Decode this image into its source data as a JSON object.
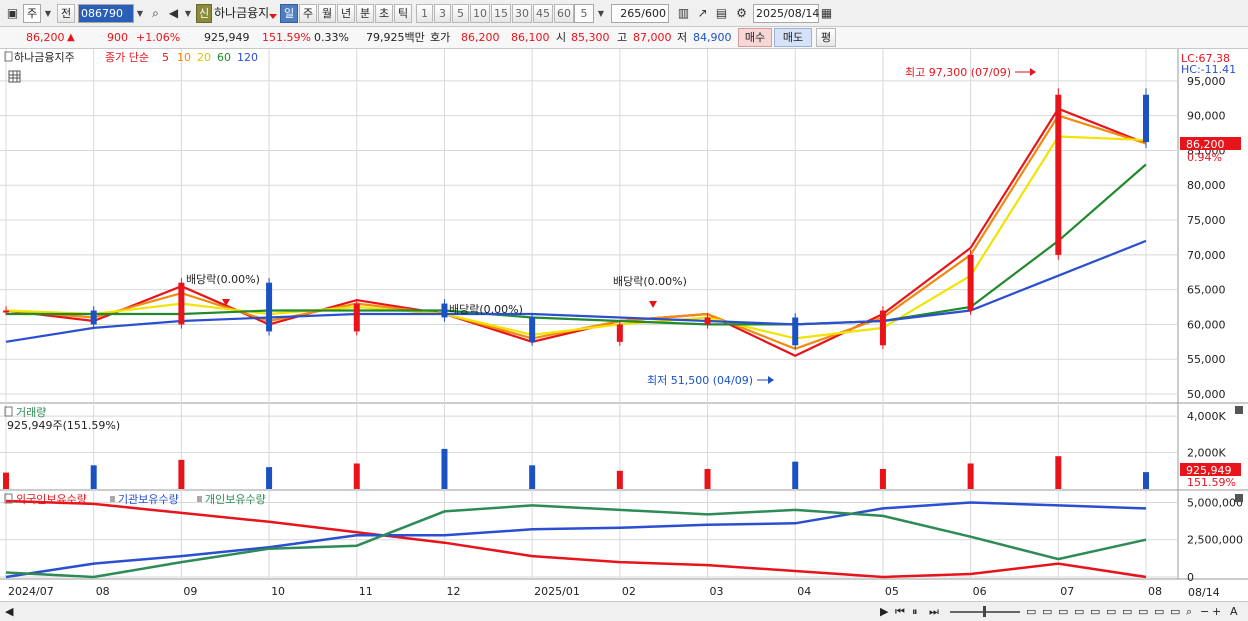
{
  "toolbar": {
    "market_type": "주",
    "prev_label": "전",
    "stock_code": "086790",
    "stock_name": "하나금융지",
    "new_badge": "신",
    "periods": [
      "일",
      "주",
      "월",
      "년",
      "분",
      "초",
      "틱"
    ],
    "selected_period": "일",
    "intervals": [
      "1",
      "3",
      "5",
      "10",
      "15",
      "30",
      "45",
      "60"
    ],
    "interval_value": "5",
    "count_current": "265",
    "count_total": "/600",
    "date": "2025/08/14"
  },
  "quote": {
    "price": "86,200",
    "change": "900",
    "change_pct": "+1.06%",
    "volume": "925,949",
    "volume_ratio": "151.59%",
    "turnover": "0.33%",
    "amount": "79,925백만",
    "bid_label": "호가",
    "ask_price": "86,200",
    "bid_price": "86,100",
    "open_label": "시",
    "open": "85,300",
    "high_label": "고",
    "high": "87,000",
    "low_label": "저",
    "low": "84,900",
    "buy_label": "매수",
    "sell_label": "매도",
    "eval_label": "평"
  },
  "price_panel": {
    "title": "하나금융지주",
    "ma_label": "종가 단순",
    "ma_periods": [
      "5",
      "10",
      "20",
      "60",
      "120"
    ],
    "ma_colors": [
      "#e8141b",
      "#f08a10",
      "#f2e300",
      "#1f8a2e",
      "#2a4fd0"
    ],
    "lc": "LC:67.38",
    "hc": "HC:-11.41",
    "current_price": "86,200",
    "current_pct": "0.94%",
    "y_ticks": [
      "95,000",
      "90,000",
      "85,000",
      "80,000",
      "75,000",
      "70,000",
      "65,000",
      "60,000",
      "55,000",
      "50,000"
    ],
    "high_note": "최고 97,300 (07/09)",
    "low_note": "최저 51,500 (04/09)",
    "dividend_notes": [
      "배당락(0.00%)",
      "배당락(0.00%)",
      "배당락(0.00%)"
    ]
  },
  "volume_panel": {
    "title": "거래량",
    "value_note": "925,949주(151.59%)",
    "y_ticks": [
      "4,000K",
      "2,000K"
    ],
    "current": "925,949",
    "current_pct": "151.59%"
  },
  "holding_panel": {
    "series_names": [
      "외국인보유수량",
      "기관보유수량",
      "개인보유수량"
    ],
    "series_colors": [
      "#e8141b",
      "#2a4fd0",
      "#2e8b57"
    ],
    "y_ticks": [
      "5,000,000",
      "2,500,000",
      "0"
    ]
  },
  "x_axis": {
    "labels": [
      "2024/07",
      "08",
      "09",
      "10",
      "11",
      "12",
      "2025/01",
      "02",
      "03",
      "04",
      "05",
      "06",
      "07",
      "08"
    ],
    "right_label": "08/14"
  },
  "colors": {
    "up": "#e8141b",
    "down": "#1a52c4",
    "grid": "#d8d8d8"
  },
  "chart_data": [
    {
      "type": "candlestick",
      "title": "하나금융지주",
      "x": [
        "2024/07",
        "08",
        "09",
        "10",
        "11",
        "12",
        "2025/01",
        "02",
        "03",
        "04",
        "05",
        "06",
        "07",
        "08"
      ],
      "series": [
        {
          "name": "종가",
          "values": [
            62000,
            60000,
            66000,
            59000,
            63000,
            61000,
            57500,
            60000,
            61000,
            57000,
            62000,
            70000,
            93000,
            86200
          ]
        },
        {
          "name": "5",
          "values": [
            62000,
            60500,
            65500,
            60000,
            63500,
            61500,
            57500,
            60500,
            61500,
            55500,
            61500,
            71000,
            91000,
            86000
          ]
        },
        {
          "name": "10",
          "values": [
            62000,
            61000,
            64500,
            60500,
            63000,
            61500,
            58000,
            60500,
            61500,
            56500,
            61000,
            70000,
            90000,
            86000
          ]
        },
        {
          "name": "20",
          "values": [
            62000,
            61500,
            63000,
            61500,
            62500,
            61500,
            58500,
            60000,
            61000,
            58000,
            59500,
            67000,
            87000,
            86500
          ]
        },
        {
          "name": "60",
          "values": [
            61500,
            61500,
            61500,
            62000,
            62000,
            62000,
            61000,
            60500,
            60000,
            60000,
            60500,
            62500,
            72000,
            83000
          ]
        },
        {
          "name": "120",
          "values": [
            57500,
            59500,
            60500,
            61000,
            61500,
            61500,
            61500,
            61000,
            60500,
            60000,
            60500,
            62000,
            67000,
            72000
          ]
        }
      ],
      "ylim": [
        49000,
        99000
      ],
      "annotations": [
        {
          "text": "최고 97,300 (07/09)",
          "x": "07/09",
          "y": 97300
        },
        {
          "text": "최저 51,500 (04/09)",
          "x": "04/09",
          "y": 51500
        }
      ]
    },
    {
      "type": "bar",
      "title": "거래량",
      "x": [
        "2024/07",
        "08",
        "09",
        "10",
        "11",
        "12",
        "2025/01",
        "02",
        "03",
        "04",
        "05",
        "06",
        "07",
        "08"
      ],
      "values": [
        900000,
        1300000,
        1600000,
        1200000,
        1400000,
        2200000,
        1300000,
        1000000,
        1100000,
        1500000,
        1100000,
        1400000,
        1800000,
        925949
      ],
      "ylim": [
        0,
        4500000
      ]
    },
    {
      "type": "line",
      "x": [
        "2024/07",
        "08",
        "09",
        "10",
        "11",
        "12",
        "2025/01",
        "02",
        "03",
        "04",
        "05",
        "06",
        "07",
        "08"
      ],
      "series": [
        {
          "name": "외국인보유수량",
          "values": [
            5100000,
            4900000,
            4300000,
            3700000,
            3000000,
            2300000,
            1400000,
            1000000,
            800000,
            400000,
            0,
            200000,
            900000,
            0
          ]
        },
        {
          "name": "기관보유수량",
          "values": [
            0,
            900000,
            1400000,
            2000000,
            2800000,
            2800000,
            3200000,
            3300000,
            3500000,
            3600000,
            4600000,
            5000000,
            4800000,
            4600000
          ]
        },
        {
          "name": "개인보유수량",
          "values": [
            300000,
            0,
            1000000,
            1900000,
            2100000,
            4400000,
            4800000,
            4500000,
            4200000,
            4500000,
            4100000,
            2700000,
            1200000,
            2500000
          ]
        }
      ],
      "ylim": [
        0,
        5500000
      ]
    }
  ]
}
